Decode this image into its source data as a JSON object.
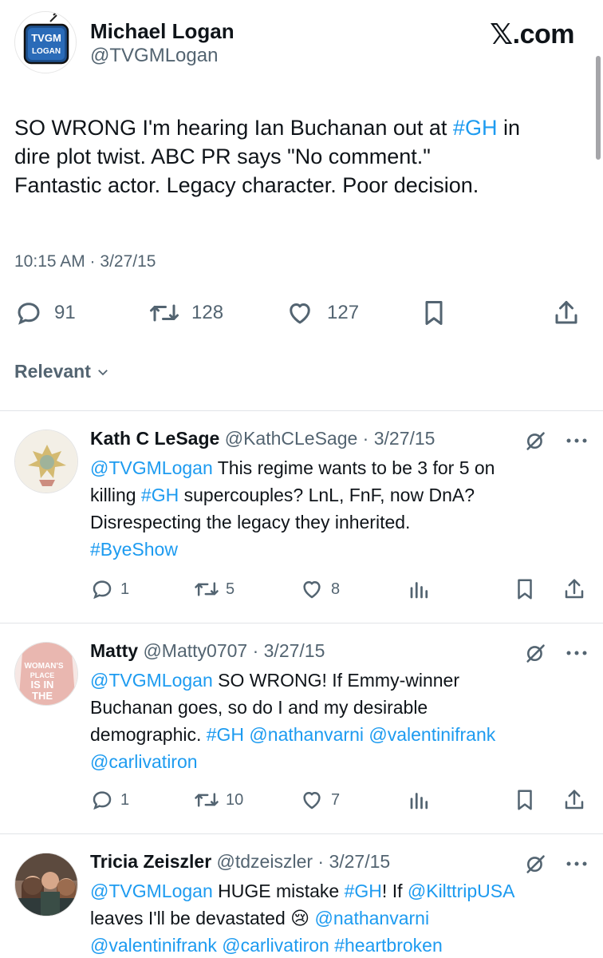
{
  "site": "X.com",
  "site_logo_glyph": "𝕏",
  "site_suffix": ".com",
  "author": {
    "name": "Michael Logan",
    "handle": "@TVGMLogan",
    "avatar_line1": "TVGM",
    "avatar_line2": "LOGAN"
  },
  "tweet": {
    "lines": [
      [
        "SO WRONG I'm hearing Ian Buchanan out at ",
        "#GH",
        " in"
      ],
      [
        "dire plot twist. ABC PR says \"No comment.\""
      ],
      [
        "Fantastic actor. Legacy character. Poor decision."
      ]
    ],
    "timestamp": "10:15 AM · 3/27/15",
    "stats": {
      "replies": "91",
      "reposts": "128",
      "likes": "127"
    }
  },
  "sort_label": "Relevant",
  "replies": [
    {
      "name": "Kath C LeSage",
      "meta": " @KathCLeSage · 3/27/15",
      "lines": [
        [
          "@TVGMLogan",
          " This regime wants to be 3 for 5 on"
        ],
        [
          "killing ",
          "#GH",
          " supercouples? LnL, FnF, now DnA?"
        ],
        [
          "Disrespecting the legacy they inherited."
        ],
        [
          "#ByeShow"
        ]
      ],
      "stats": {
        "replies": "1",
        "reposts": "5",
        "likes": "8"
      }
    },
    {
      "name": "Matty",
      "meta": " @Matty0707 · 3/27/15",
      "avatar_text": "WOMAN'S PLACE IS IN THE",
      "lines": [
        [
          "@TVGMLogan",
          " SO WRONG! If Emmy-winner"
        ],
        [
          "Buchanan goes, so do I and my desirable"
        ],
        [
          "demographic. ",
          "#GH @nathanvarni @valentinifrank"
        ],
        [
          "@carlivatiron"
        ]
      ],
      "stats": {
        "replies": "1",
        "reposts": "10",
        "likes": "7"
      }
    },
    {
      "name": "Tricia Zeiszler",
      "meta": " @tdzeiszler · 3/27/15",
      "lines": [
        [
          "@TVGMLogan",
          " HUGE mistake ",
          "#GH",
          "! If ",
          "@KilttripUSA"
        ],
        [
          "leaves I'll be devastated 😢 ",
          "@nathanvarni"
        ],
        [
          "@valentinifrank @carlivatiron #heartbroken"
        ]
      ]
    }
  ],
  "icons": [
    "reply-icon",
    "repost-icon",
    "like-icon",
    "bookmark-icon",
    "share-icon",
    "views-icon",
    "grok-icon",
    "more-icon",
    "chevron-down-icon"
  ],
  "colors": {
    "link": "#1d9bf0",
    "muted": "#536471",
    "text": "#0f1419"
  }
}
